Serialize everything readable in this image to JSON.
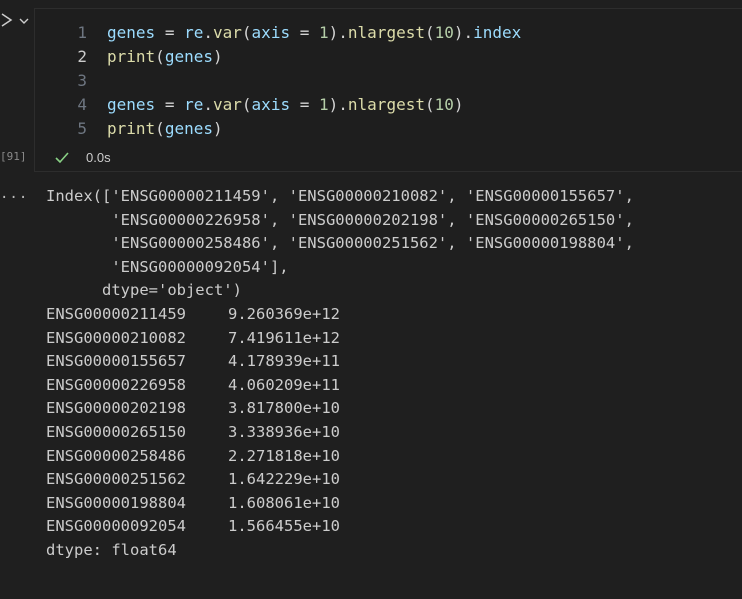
{
  "cell": {
    "execution_count": "[91]",
    "exec_time": "0.0s",
    "lines": [
      {
        "number": "1",
        "tokens": [
          {
            "t": "genes",
            "c": "var"
          },
          {
            "t": " ",
            "c": "plain"
          },
          {
            "t": "=",
            "c": "plain"
          },
          {
            "t": " ",
            "c": "plain"
          },
          {
            "t": "re",
            "c": "var"
          },
          {
            "t": ".",
            "c": "plain"
          },
          {
            "t": "var",
            "c": "fn"
          },
          {
            "t": "(",
            "c": "plain"
          },
          {
            "t": "axis",
            "c": "var"
          },
          {
            "t": " ",
            "c": "plain"
          },
          {
            "t": "=",
            "c": "plain"
          },
          {
            "t": " ",
            "c": "plain"
          },
          {
            "t": "1",
            "c": "num"
          },
          {
            "t": ").",
            "c": "plain"
          },
          {
            "t": "nlargest",
            "c": "fn"
          },
          {
            "t": "(",
            "c": "plain"
          },
          {
            "t": "10",
            "c": "num"
          },
          {
            "t": ").",
            "c": "plain"
          },
          {
            "t": "index",
            "c": "var"
          }
        ]
      },
      {
        "number": "2",
        "active": true,
        "tokens": [
          {
            "t": "print",
            "c": "fn"
          },
          {
            "t": "(",
            "c": "plain"
          },
          {
            "t": "genes",
            "c": "var"
          },
          {
            "t": ")",
            "c": "plain"
          }
        ]
      },
      {
        "number": "3",
        "tokens": []
      },
      {
        "number": "4",
        "tokens": [
          {
            "t": "genes",
            "c": "var"
          },
          {
            "t": " ",
            "c": "plain"
          },
          {
            "t": "=",
            "c": "plain"
          },
          {
            "t": " ",
            "c": "plain"
          },
          {
            "t": "re",
            "c": "var"
          },
          {
            "t": ".",
            "c": "plain"
          },
          {
            "t": "var",
            "c": "fn"
          },
          {
            "t": "(",
            "c": "plain"
          },
          {
            "t": "axis",
            "c": "var"
          },
          {
            "t": " ",
            "c": "plain"
          },
          {
            "t": "=",
            "c": "plain"
          },
          {
            "t": " ",
            "c": "plain"
          },
          {
            "t": "1",
            "c": "num"
          },
          {
            "t": ").",
            "c": "plain"
          },
          {
            "t": "nlargest",
            "c": "fn"
          },
          {
            "t": "(",
            "c": "plain"
          },
          {
            "t": "10",
            "c": "num"
          },
          {
            "t": ")",
            "c": "plain"
          }
        ]
      },
      {
        "number": "5",
        "tokens": [
          {
            "t": "print",
            "c": "fn"
          },
          {
            "t": "(",
            "c": "plain"
          },
          {
            "t": "genes",
            "c": "var"
          },
          {
            "t": ")",
            "c": "plain"
          }
        ]
      }
    ]
  },
  "output": {
    "menu_icon": "...",
    "index_lines": [
      "Index(['ENSG00000211459', 'ENSG00000210082', 'ENSG00000155657',",
      "       'ENSG00000226958', 'ENSG00000202198', 'ENSG00000265150',",
      "       'ENSG00000258486', 'ENSG00000251562', 'ENSG00000198804',",
      "       'ENSG00000092054'],",
      "      dtype='object')"
    ],
    "series": [
      {
        "key": "ENSG00000211459",
        "value": "9.260369e+12"
      },
      {
        "key": "ENSG00000210082",
        "value": "7.419611e+12"
      },
      {
        "key": "ENSG00000155657",
        "value": "4.178939e+11"
      },
      {
        "key": "ENSG00000226958",
        "value": "4.060209e+11"
      },
      {
        "key": "ENSG00000202198",
        "value": "3.817800e+10"
      },
      {
        "key": "ENSG00000265150",
        "value": "3.338936e+10"
      },
      {
        "key": "ENSG00000258486",
        "value": "2.271818e+10"
      },
      {
        "key": "ENSG00000251562",
        "value": "1.642229e+10"
      },
      {
        "key": "ENSG00000198804",
        "value": "1.608061e+10"
      },
      {
        "key": "ENSG00000092054",
        "value": "1.566455e+10"
      }
    ],
    "dtype_line": "dtype: float64"
  },
  "icons": {
    "run": "run-cell-icon",
    "chevron": "chevron-down-icon",
    "check": "check-icon"
  },
  "colors": {
    "background": "#1f1f1f",
    "check_green": "#89d185"
  }
}
